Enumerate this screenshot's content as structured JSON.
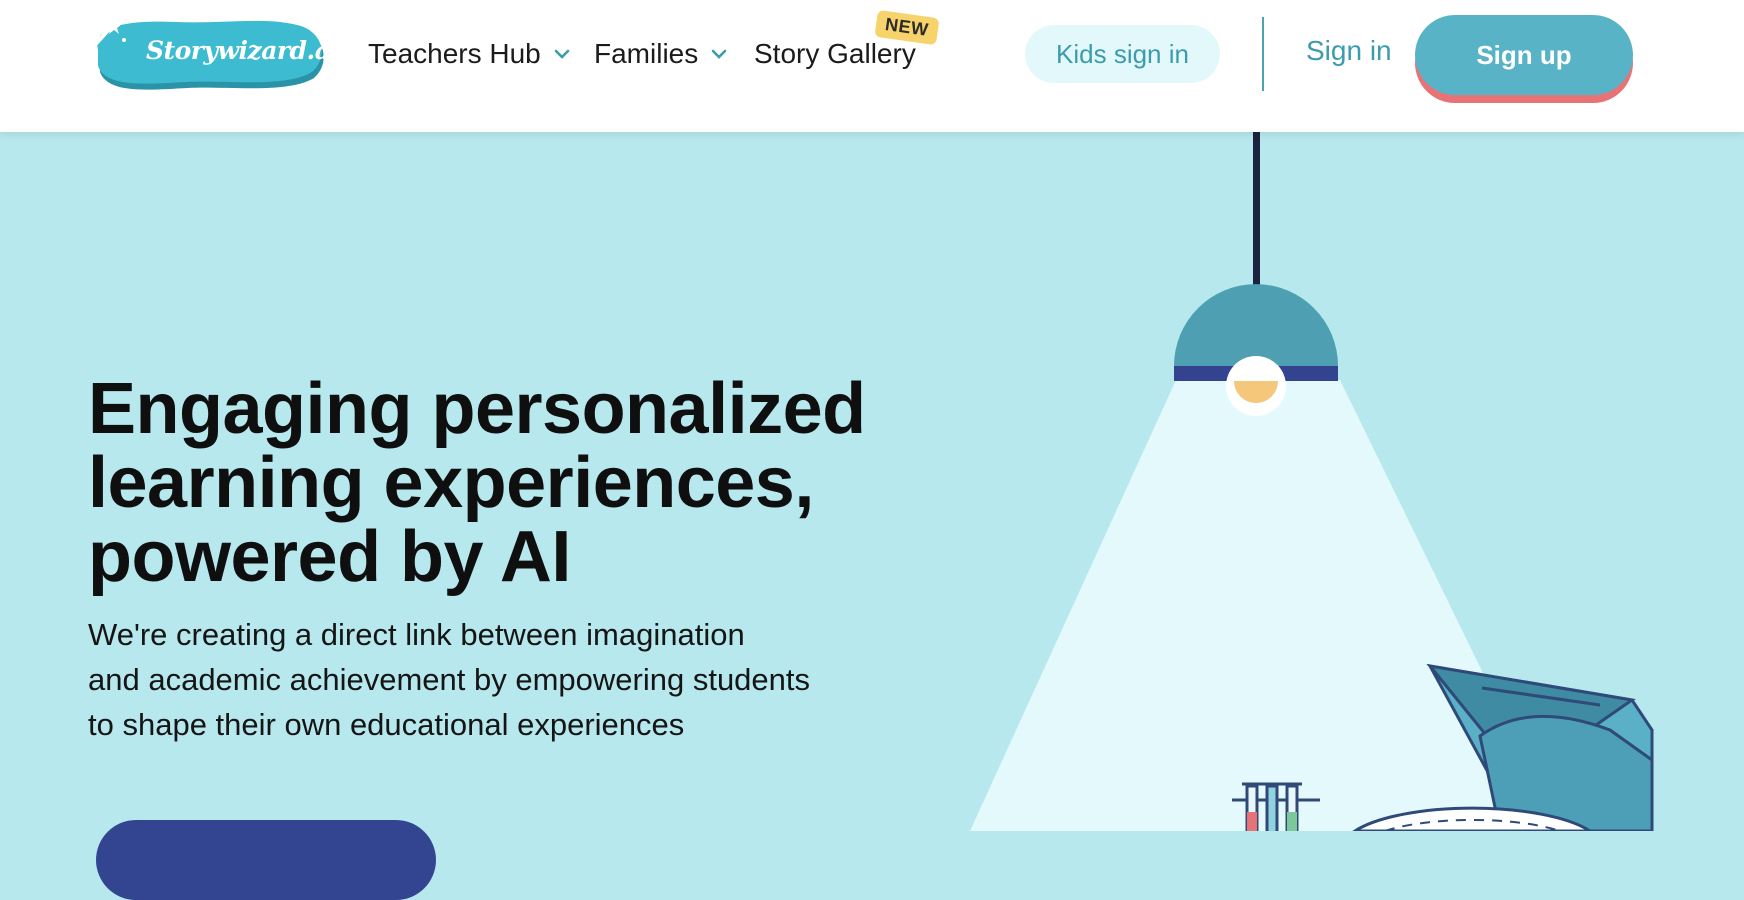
{
  "header": {
    "logo_text": "Storywizard.ai",
    "nav": [
      {
        "label": "Teachers Hub",
        "has_dropdown": true
      },
      {
        "label": "Families",
        "has_dropdown": true
      },
      {
        "label": "Story Gallery",
        "has_dropdown": false,
        "badge": "NEW"
      }
    ],
    "kids_signin_label": "Kids sign in",
    "signin_label": "Sign in",
    "signup_label": "Sign up"
  },
  "hero": {
    "title_lines": [
      "Engaging personalized",
      "learning experiences,",
      "powered by AI"
    ],
    "subtitle_lines": [
      "We're creating a direct link between imagination",
      "and academic achievement by empowering students",
      "to shape their own educational experiences"
    ]
  },
  "icons": {
    "chevron": "chevron-down-icon",
    "wand": "magic-wand-icon",
    "lamp": "ceiling-lamp-illustration",
    "cap": "graduation-cap-illustration",
    "tubes": "test-tubes-illustration"
  },
  "colors": {
    "background": "#b6e8ee",
    "accent": "#58b3c7",
    "accent_dark": "#334591",
    "coral": "#e87377",
    "badge": "#f7d36b",
    "text": "#0f0f0f"
  }
}
